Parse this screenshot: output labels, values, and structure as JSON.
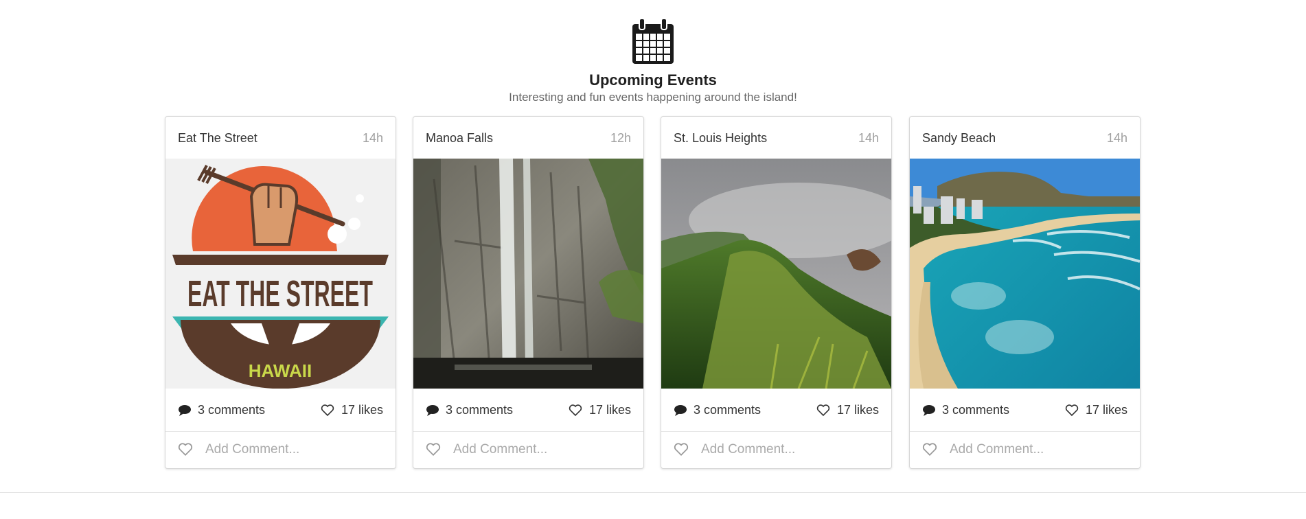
{
  "header": {
    "title": "Upcoming Events",
    "subtitle": "Interesting and fun events happening around the island!",
    "icon": "calendar-icon"
  },
  "cards": [
    {
      "name": "Eat The Street",
      "time": "14h",
      "comments": "3 comments",
      "likes": "17 likes",
      "add_placeholder": "Add Comment...",
      "logo_text": "EAT THE STREET",
      "logo_subtext": "HAWAII"
    },
    {
      "name": "Manoa Falls",
      "time": "12h",
      "comments": "3 comments",
      "likes": "17 likes",
      "add_placeholder": "Add Comment..."
    },
    {
      "name": "St. Louis Heights",
      "time": "14h",
      "comments": "3 comments",
      "likes": "17 likes",
      "add_placeholder": "Add Comment..."
    },
    {
      "name": "Sandy Beach",
      "time": "14h",
      "comments": "3 comments",
      "likes": "17 likes",
      "add_placeholder": "Add Comment..."
    }
  ],
  "colors": {
    "accent_orange": "#e8643a",
    "brown": "#5a3b2b",
    "teal": "#3bb5b0"
  }
}
